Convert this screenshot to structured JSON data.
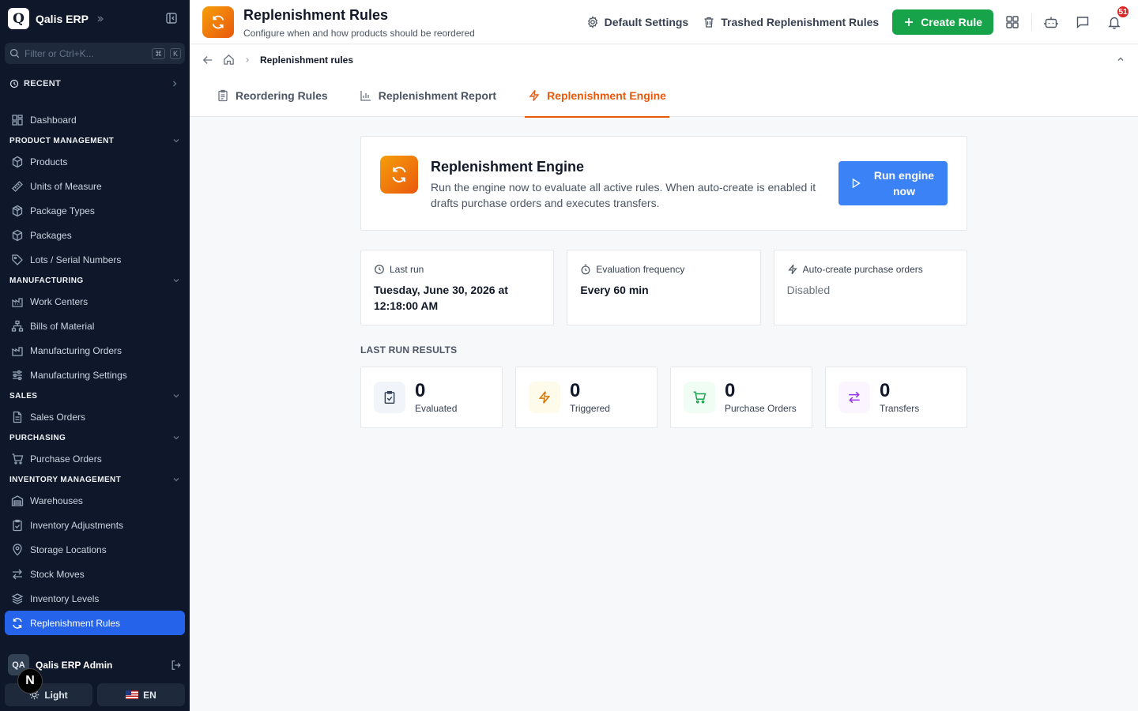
{
  "app": {
    "brand_initial": "Q",
    "brand_name": "Qalis ERP",
    "filter_placeholder": "Filter or Ctrl+K...",
    "kbd_cmd": "⌘",
    "kbd_k": "K",
    "recent_label": "RECENT"
  },
  "sidebar": {
    "dashboard": "Dashboard",
    "sections": {
      "product_management": "PRODUCT MANAGEMENT",
      "manufacturing": "MANUFACTURING",
      "sales": "SALES",
      "purchasing": "PURCHASING",
      "inventory_management": "INVENTORY MANAGEMENT"
    },
    "items": {
      "products": "Products",
      "units_of_measure": "Units of Measure",
      "package_types": "Package Types",
      "packages": "Packages",
      "lots_serial_numbers": "Lots / Serial Numbers",
      "work_centers": "Work Centers",
      "bills_of_material": "Bills of Material",
      "manufacturing_orders": "Manufacturing Orders",
      "manufacturing_settings": "Manufacturing Settings",
      "sales_orders": "Sales Orders",
      "purchase_orders": "Purchase Orders",
      "warehouses": "Warehouses",
      "inventory_adjustments": "Inventory Adjustments",
      "storage_locations": "Storage Locations",
      "stock_moves": "Stock Moves",
      "inventory_levels": "Inventory Levels",
      "replenishment_rules": "Replenishment Rules"
    },
    "user": {
      "initials": "QA",
      "name": "Qalis ERP Admin"
    },
    "theme_label": "Light",
    "language_label": "EN",
    "n_badge": "N"
  },
  "header": {
    "title": "Replenishment Rules",
    "subtitle": "Configure when and how products should be reordered",
    "default_settings": "Default Settings",
    "trashed_rules": "Trashed Replenishment Rules",
    "create_rule": "Create Rule",
    "notification_count": "51"
  },
  "breadcrumb": {
    "current": "Replenishment rules"
  },
  "tabs": {
    "reordering_rules": "Reordering Rules",
    "replenishment_report": "Replenishment Report",
    "replenishment_engine": "Replenishment Engine"
  },
  "engine": {
    "title": "Replenishment Engine",
    "description": "Run the engine now to evaluate all active rules. When auto-create is enabled it drafts purchase orders and executes transfers.",
    "run_button": "Run engine now"
  },
  "info": {
    "last_run_label": "Last run",
    "last_run_value": "Tuesday, June 30, 2026 at 12:18:00 AM",
    "frequency_label": "Evaluation frequency",
    "frequency_value": "Every 60 min",
    "auto_create_label": "Auto-create purchase orders",
    "auto_create_value": "Disabled"
  },
  "results": {
    "section_label": "LAST RUN RESULTS",
    "evaluated": {
      "value": "0",
      "label": "Evaluated"
    },
    "triggered": {
      "value": "0",
      "label": "Triggered"
    },
    "purchase_orders": {
      "value": "0",
      "label": "Purchase Orders"
    },
    "transfers": {
      "value": "0",
      "label": "Transfers"
    }
  },
  "colors": {
    "accent_orange": "#ea580c",
    "primary_blue": "#3b82f6",
    "success_green": "#16a34a",
    "sidebar_bg": "#0f172a",
    "sidebar_active": "#2563eb",
    "badge_red": "#dc2626"
  }
}
